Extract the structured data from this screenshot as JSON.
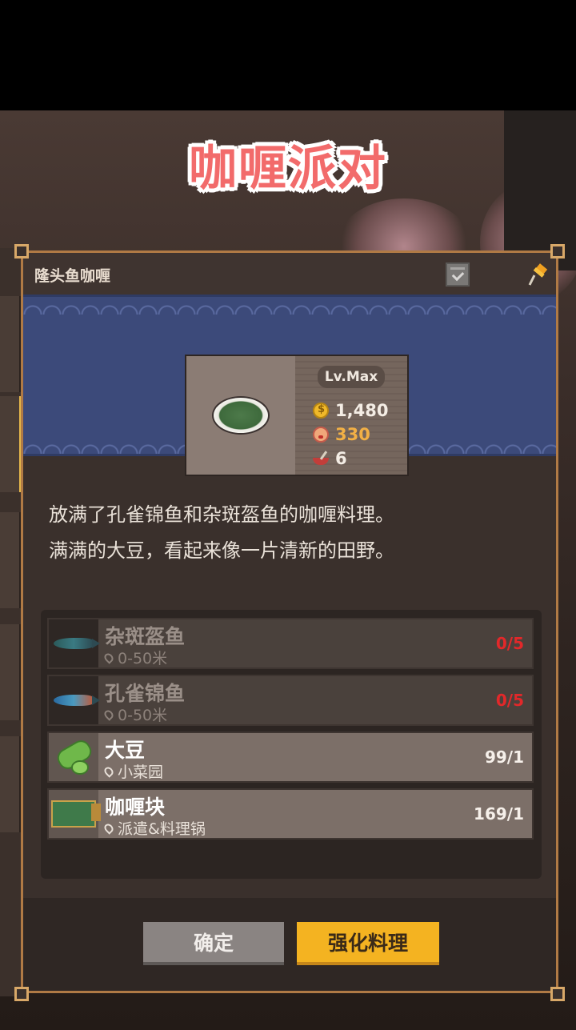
{
  "title_banner": "咖喱派对",
  "panel": {
    "title": "隆头鱼咖喱"
  },
  "item": {
    "level": "Lv.Max",
    "stats": {
      "price": "1,480",
      "taste": "330",
      "servings": "6"
    }
  },
  "description": {
    "line1": "放满了孔雀锦鱼和杂斑盔鱼的咖喱料理。",
    "line2": "满满的大豆，看起来像一片清新的田野。"
  },
  "ingredients": [
    {
      "name": "杂斑盔鱼",
      "location": "0-50米",
      "count": "0/5",
      "icon": "fish-icon"
    },
    {
      "name": "孔雀锦鱼",
      "location": "0-50米",
      "count": "0/5",
      "icon": "peacock-fish-icon"
    },
    {
      "name": "大豆",
      "location": "小菜园",
      "count": "99/1",
      "icon": "soybean-icon"
    },
    {
      "name": "咖喱块",
      "location": "派遣&料理锅",
      "count": "169/1",
      "icon": "curry-block-icon"
    }
  ],
  "buttons": {
    "confirm": "确定",
    "enhance": "强化料理"
  },
  "colors": {
    "banner_blue": "#3c4a7a",
    "enhance_yellow": "#f4b321",
    "missing_red": "#e2282a",
    "frame_brown": "#b07a45"
  }
}
